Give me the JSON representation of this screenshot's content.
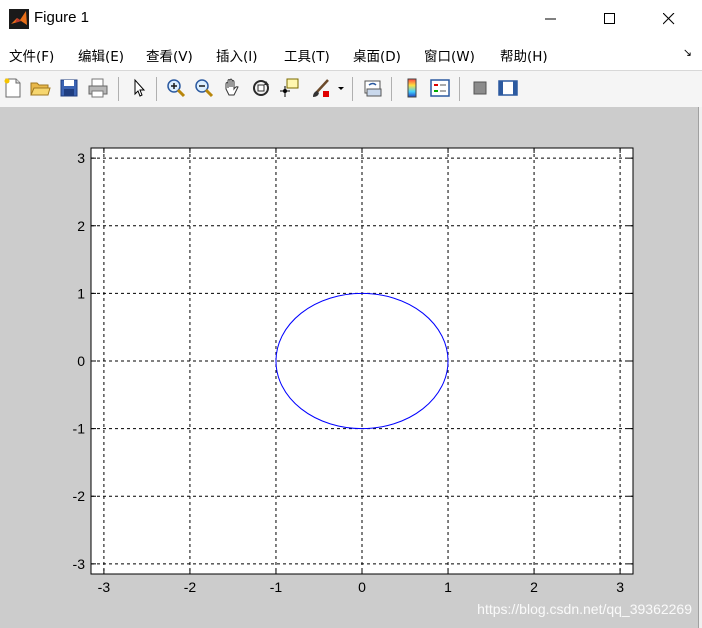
{
  "window": {
    "title": "Figure 1",
    "controls": [
      "minimize",
      "maximize",
      "close"
    ]
  },
  "menu": {
    "items": [
      "文件(F)",
      "编辑(E)",
      "查看(V)",
      "插入(I)",
      "工具(T)",
      "桌面(D)",
      "窗口(W)",
      "帮助(H)"
    ],
    "overflow_arrow": "↘"
  },
  "toolbar": {
    "icons": [
      "new-file-icon",
      "open-folder-icon",
      "save-icon",
      "print-icon",
      "pointer-icon",
      "zoom-in-icon",
      "zoom-out-icon",
      "pan-hand-icon",
      "rotate-3d-icon",
      "data-cursor-icon",
      "brush-icon",
      "brush-dropdown-icon",
      "link-plot-icon",
      "colorbar-icon",
      "legend-icon",
      "hide-plot-tools-icon",
      "show-plot-tools-icon"
    ]
  },
  "colors": {
    "canvas_bg": "#cccccc",
    "axes_bg": "#ffffff",
    "line": "#0000ff",
    "grid": "#000000"
  },
  "chart_data": {
    "type": "line",
    "title": "",
    "xlabel": "",
    "ylabel": "",
    "xlim": [
      -3.15,
      3.15
    ],
    "ylim": [
      -3.15,
      3.15
    ],
    "xticks": [
      -3,
      -2,
      -1,
      0,
      1,
      2,
      3
    ],
    "yticks": [
      -3,
      -2,
      -1,
      0,
      1,
      2,
      3
    ],
    "xtick_labels": [
      "-3",
      "-2",
      "-1",
      "0",
      "1",
      "2",
      "3"
    ],
    "ytick_labels": [
      "-3",
      "-2",
      "-1",
      "0",
      "1",
      "2",
      "3"
    ],
    "grid": true,
    "grid_style": "dashed",
    "series": [
      {
        "shape": "circle",
        "center": [
          0,
          0
        ],
        "radius": 1,
        "color": "#0000ff"
      }
    ]
  },
  "watermark": "https://blog.csdn.net/qq_39362269"
}
